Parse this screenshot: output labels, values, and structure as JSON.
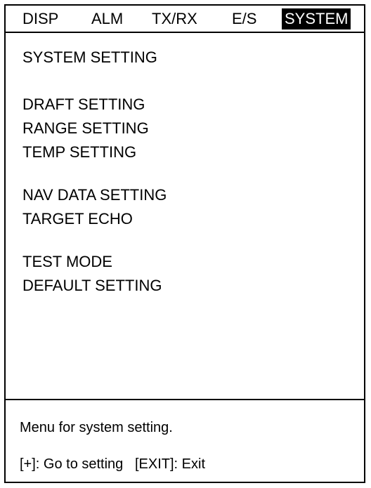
{
  "tabs": [
    {
      "label": "DISP",
      "active": false
    },
    {
      "label": "ALM",
      "active": false
    },
    {
      "label": "TX/RX",
      "active": false
    },
    {
      "label": "E/S",
      "active": false
    },
    {
      "label": "SYSTEM",
      "active": true
    }
  ],
  "menu": {
    "title": "SYSTEM SETTING",
    "items": [
      "DRAFT SETTING",
      "RANGE SETTING",
      "TEMP SETTING",
      "NAV DATA SETTING",
      "TARGET ECHO",
      "TEST MODE",
      "DEFAULT SETTING"
    ]
  },
  "help": {
    "description": "Menu for system setting.",
    "keys": "[+]: Go to setting   [EXIT]: Exit"
  },
  "colors": {
    "background": "#ffffff",
    "foreground": "#000000",
    "active_tab_bg": "#000000",
    "active_tab_fg": "#ffffff"
  }
}
